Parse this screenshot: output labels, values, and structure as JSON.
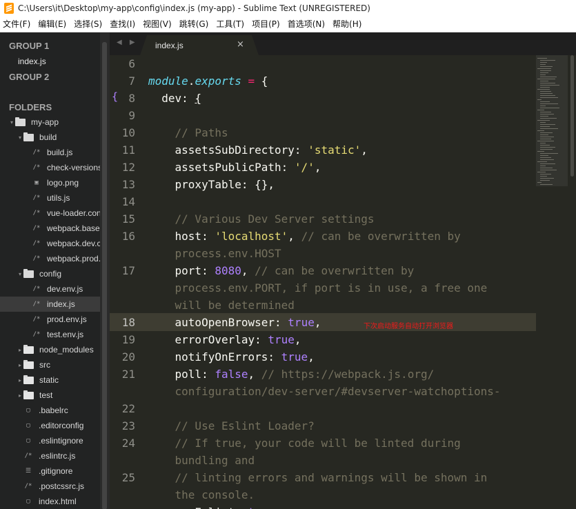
{
  "window": {
    "title": "C:\\Users\\it\\Desktop\\my-app\\config\\index.js (my-app) - Sublime Text (UNREGISTERED)"
  },
  "menu": [
    "文件(F)",
    "编辑(E)",
    "选择(S)",
    "查找(I)",
    "视图(V)",
    "跳转(G)",
    "工具(T)",
    "项目(P)",
    "首选项(N)",
    "帮助(H)"
  ],
  "sidebar": {
    "group1": "GROUP 1",
    "group1_file": "index.js",
    "group2": "GROUP 2",
    "folders_label": "FOLDERS",
    "tree": [
      {
        "label": "my-app",
        "type": "folder",
        "depth": 0,
        "open": true
      },
      {
        "label": "build",
        "type": "folder",
        "depth": 1,
        "open": true
      },
      {
        "label": "build.js",
        "type": "js",
        "depth": 2
      },
      {
        "label": "check-versions.js",
        "type": "js",
        "depth": 2
      },
      {
        "label": "logo.png",
        "type": "img",
        "depth": 2
      },
      {
        "label": "utils.js",
        "type": "js",
        "depth": 2
      },
      {
        "label": "vue-loader.conf.js",
        "type": "js",
        "depth": 2
      },
      {
        "label": "webpack.base.conf.js",
        "type": "js",
        "depth": 2
      },
      {
        "label": "webpack.dev.conf.js",
        "type": "js",
        "depth": 2
      },
      {
        "label": "webpack.prod.conf.js",
        "type": "js",
        "depth": 2
      },
      {
        "label": "config",
        "type": "folder",
        "depth": 1,
        "open": true
      },
      {
        "label": "dev.env.js",
        "type": "js",
        "depth": 2
      },
      {
        "label": "index.js",
        "type": "js",
        "depth": 2,
        "selected": true
      },
      {
        "label": "prod.env.js",
        "type": "js",
        "depth": 2
      },
      {
        "label": "test.env.js",
        "type": "js",
        "depth": 2
      },
      {
        "label": "node_modules",
        "type": "folder",
        "depth": 1,
        "open": false
      },
      {
        "label": "src",
        "type": "folder",
        "depth": 1,
        "open": false
      },
      {
        "label": "static",
        "type": "folder",
        "depth": 1,
        "open": false
      },
      {
        "label": "test",
        "type": "folder",
        "depth": 1,
        "open": false
      },
      {
        "label": ".babelrc",
        "type": "doc",
        "depth": 1
      },
      {
        "label": ".editorconfig",
        "type": "doc",
        "depth": 1
      },
      {
        "label": ".eslintignore",
        "type": "doc",
        "depth": 1
      },
      {
        "label": ".eslintrc.js",
        "type": "js",
        "depth": 1
      },
      {
        "label": ".gitignore",
        "type": "list",
        "depth": 1
      },
      {
        "label": ".postcssrc.js",
        "type": "js",
        "depth": 1
      },
      {
        "label": "index.html",
        "type": "doc",
        "depth": 1
      }
    ]
  },
  "tab": {
    "label": "index.js",
    "close": "×",
    "nav": "◀ ▶"
  },
  "editor": {
    "current_line": "18",
    "fold_marker": "{",
    "gutter": [
      "6",
      "7",
      "8",
      "",
      "10",
      "11",
      "12",
      "13",
      "14",
      "15",
      "16",
      "",
      "17",
      "",
      "",
      "18",
      "19",
      "20",
      "21",
      "",
      "22",
      "23",
      "24",
      "",
      "25",
      "",
      ""
    ],
    "gutter_extra": {
      "row3": "9"
    },
    "lines": [
      [],
      [
        [
          "k",
          "module"
        ],
        [
          "p",
          "."
        ],
        [
          "k",
          "exports"
        ],
        [
          "p",
          " "
        ],
        [
          "o",
          "="
        ],
        [
          "p",
          " {"
        ]
      ],
      [
        [
          "p",
          "  dev: "
        ],
        [
          "u",
          "{"
        ]
      ],
      [],
      [
        [
          "p",
          "    "
        ],
        [
          "c",
          "// Paths"
        ]
      ],
      [
        [
          "p",
          "    assetsSubDirectory: "
        ],
        [
          "s",
          "'static'"
        ],
        [
          "p",
          ","
        ]
      ],
      [
        [
          "p",
          "    assetsPublicPath: "
        ],
        [
          "s",
          "'/'"
        ],
        [
          "p",
          ","
        ]
      ],
      [
        [
          "p",
          "    proxyTable: {},"
        ]
      ],
      [],
      [
        [
          "p",
          "    "
        ],
        [
          "c",
          "// Various Dev Server settings"
        ]
      ],
      [
        [
          "p",
          "    host: "
        ],
        [
          "s",
          "'localhost'"
        ],
        [
          "p",
          ", "
        ],
        [
          "c",
          "// can be overwritten by"
        ]
      ],
      [
        [
          "c",
          "    process.env.HOST"
        ]
      ],
      [
        [
          "p",
          "    port: "
        ],
        [
          "b",
          "8080"
        ],
        [
          "p",
          ", "
        ],
        [
          "c",
          "// can be overwritten by"
        ]
      ],
      [
        [
          "c",
          "    process.env.PORT, if port is in use, a free one"
        ]
      ],
      [
        [
          "c",
          "    will be determined"
        ]
      ],
      [
        [
          "p",
          "    autoOpenBrowser: "
        ],
        [
          "b",
          "true"
        ],
        [
          "p",
          ","
        ]
      ],
      [
        [
          "p",
          "    errorOverlay: "
        ],
        [
          "b",
          "true"
        ],
        [
          "p",
          ","
        ]
      ],
      [
        [
          "p",
          "    notifyOnErrors: "
        ],
        [
          "b",
          "true"
        ],
        [
          "p",
          ","
        ]
      ],
      [
        [
          "p",
          "    poll: "
        ],
        [
          "b",
          "false"
        ],
        [
          "p",
          ", "
        ],
        [
          "c",
          "// https://webpack.js.org/"
        ]
      ],
      [
        [
          "c",
          "    configuration/dev-server/#devserver-watchoptions-"
        ]
      ],
      [],
      [
        [
          "p",
          "    "
        ],
        [
          "c",
          "// Use Eslint Loader?"
        ]
      ],
      [
        [
          "p",
          "    "
        ],
        [
          "c",
          "// If true, your code will be linted during"
        ]
      ],
      [
        [
          "c",
          "    bundling and"
        ]
      ],
      [
        [
          "p",
          "    "
        ],
        [
          "c",
          "// linting errors and warnings will be shown in"
        ]
      ],
      [
        [
          "c",
          "    the console."
        ]
      ],
      [
        [
          "p",
          "    useEslint: "
        ],
        [
          "b",
          "true"
        ],
        [
          "p",
          ","
        ]
      ]
    ],
    "annotation": "下次启动服务自动打开浏览器"
  },
  "colors": {
    "background": "#272822",
    "keyword": "#66d9ef",
    "operator": "#f92672",
    "string": "#e6db74",
    "comment": "#75715e",
    "constant": "#ae81ff",
    "annotation": "#f11a1a"
  },
  "icons": {
    "app": "sublime-text-icon",
    "folder": "folder-icon",
    "js": "js-file-icon",
    "img": "image-file-icon",
    "doc": "document-icon",
    "list": "list-file-icon"
  }
}
